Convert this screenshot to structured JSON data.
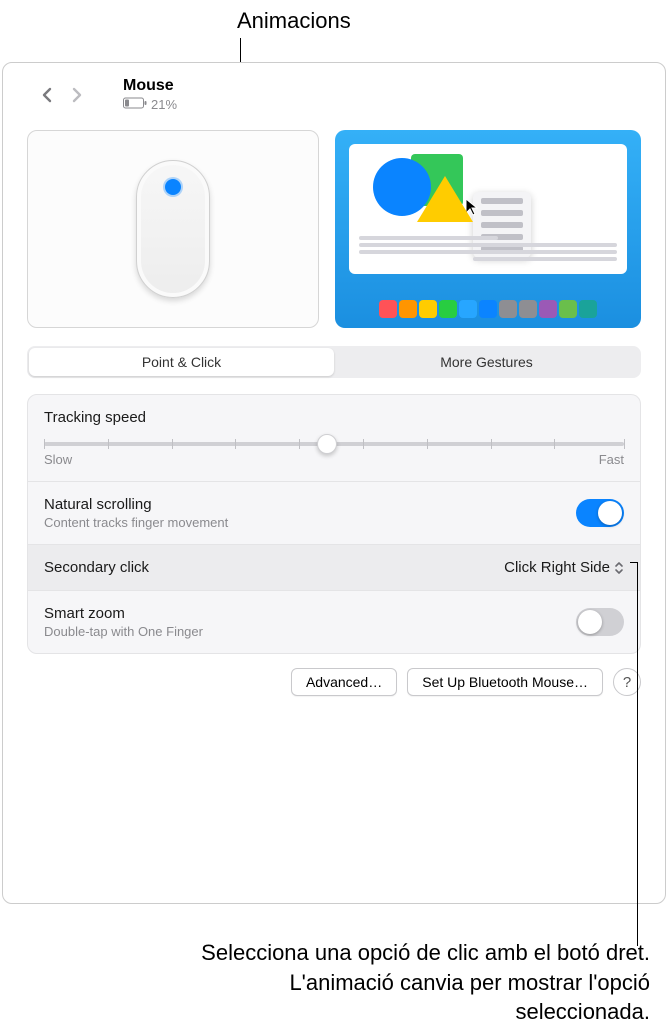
{
  "callouts": {
    "top": "Animacions",
    "bottom": "Selecciona una opció de clic amb el botó dret. L'animació canvia per mostrar l'opció seleccionada."
  },
  "header": {
    "title": "Mouse",
    "battery_pct": "21%"
  },
  "preview": {
    "swatches": [
      "#ff5257",
      "#ff9500",
      "#ffcc00",
      "#28cd41",
      "#27a6ff",
      "#0b84ff",
      "#8e8e93",
      "#8e8e93",
      "#9b59b6",
      "#6abf4b",
      "#1aa39a"
    ]
  },
  "tabs": {
    "point_click": "Point & Click",
    "more_gestures": "More Gestures"
  },
  "settings": {
    "tracking": {
      "label": "Tracking speed",
      "slow": "Slow",
      "fast": "Fast"
    },
    "natural": {
      "label": "Natural scrolling",
      "sub": "Content tracks finger movement",
      "on": true
    },
    "secondary": {
      "label": "Secondary click",
      "value": "Click Right Side"
    },
    "smart": {
      "label": "Smart zoom",
      "sub": "Double-tap with One Finger",
      "on": false
    }
  },
  "buttons": {
    "advanced": "Advanced…",
    "bluetooth": "Set Up Bluetooth Mouse…",
    "help": "?"
  }
}
